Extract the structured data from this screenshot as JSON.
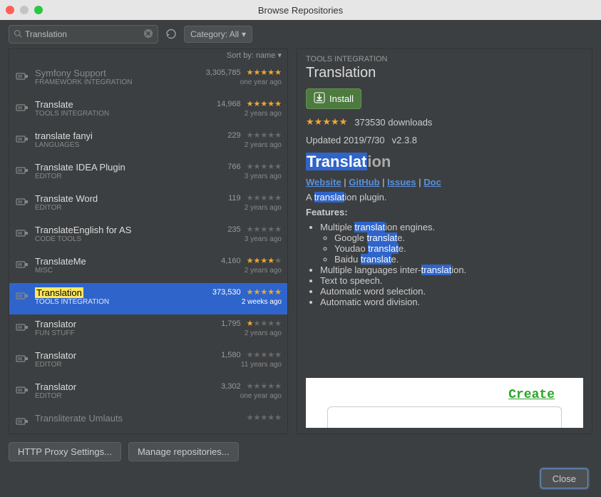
{
  "window": {
    "title": "Browse Repositories"
  },
  "toolbar": {
    "search_value": "Translation",
    "category_label": "Category: All"
  },
  "sort": {
    "label": "Sort by: name"
  },
  "plugins": [
    {
      "name": "Symfony Support",
      "category": "FRAMEWORK INTEGRATION",
      "count": "3,305,785",
      "stars": 5,
      "age": "one year ago",
      "partial": true
    },
    {
      "name": "Translate",
      "category": "TOOLS INTEGRATION",
      "count": "14,968",
      "stars": 5,
      "age": "2 years ago"
    },
    {
      "name": "translate fanyi",
      "category": "LANGUAGES",
      "count": "229",
      "stars": 0,
      "age": "2 years ago"
    },
    {
      "name": "Translate IDEA Plugin",
      "category": "EDITOR",
      "count": "766",
      "stars": 0,
      "age": "3 years ago"
    },
    {
      "name": "Translate Word",
      "category": "EDITOR",
      "count": "119",
      "stars": 0,
      "age": "2 years ago"
    },
    {
      "name": "TranslateEnglish for AS",
      "category": "CODE TOOLS",
      "count": "235",
      "stars": 0,
      "age": "3 years ago"
    },
    {
      "name": "TranslateMe",
      "category": "MISC",
      "count": "4,160",
      "stars": 4,
      "age": "2 years ago"
    },
    {
      "name": "Translation",
      "category": "TOOLS INTEGRATION",
      "count": "373,530",
      "stars": 5,
      "age": "2 weeks ago",
      "selected": true
    },
    {
      "name": "Translator",
      "category": "FUN STUFF",
      "count": "1,795",
      "stars": 1,
      "age": "2 years ago"
    },
    {
      "name": "Translator",
      "category": "EDITOR",
      "count": "1,580",
      "stars": 0,
      "age": "11 years ago"
    },
    {
      "name": "Translator",
      "category": "EDITOR",
      "count": "3,302",
      "stars": 0,
      "age": "one year ago"
    },
    {
      "name": "Transliterate Umlauts",
      "category": "",
      "count": "",
      "stars": 0,
      "age": "",
      "partial": true
    }
  ],
  "detail": {
    "category": "TOOLS INTEGRATION",
    "title": "Translation",
    "install_label": "Install",
    "downloads": "373530 downloads",
    "updated": "Updated 2019/7/30",
    "version": "v2.3.8",
    "heading_hl": "Translat",
    "heading_rest": "ion",
    "links": {
      "website": "Website",
      "github": "GitHub",
      "issues": "Issues",
      "doc": "Doc"
    },
    "summary_pre": "A ",
    "summary_hl": "translat",
    "summary_post": "ion plugin.",
    "features_label": "Features:",
    "feat1_pre": "Multiple ",
    "feat1_hl": "translat",
    "feat1_post": "ion engines.",
    "feat1a_pre": "Google ",
    "feat1a_hl": "translat",
    "feat1a_post": "e.",
    "feat1b_pre": "Youdao ",
    "feat1b_hl": "translat",
    "feat1b_post": "e.",
    "feat1c_pre": "Baidu ",
    "feat1c_hl": "translat",
    "feat1c_post": "e.",
    "feat2_pre": "Multiple languages inter-",
    "feat2_hl": "translat",
    "feat2_post": "ion.",
    "feat3": "Text to speech.",
    "feat4": "Automatic word selection.",
    "feat5": "Automatic word division.",
    "preview_word": "Create"
  },
  "bottom": {
    "proxy": "HTTP Proxy Settings...",
    "manage": "Manage repositories..."
  },
  "close_label": "Close"
}
